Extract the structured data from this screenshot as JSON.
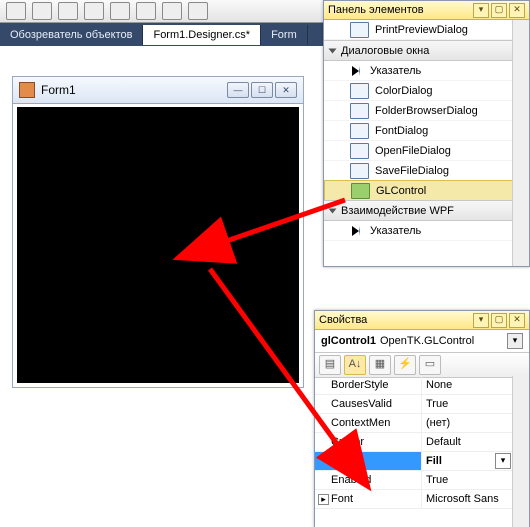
{
  "topToolbarIconCount": 8,
  "docTabs": {
    "t1": "Обозреватель объектов",
    "t2": "Form1.Designer.cs*",
    "t3": "Form"
  },
  "form1": {
    "title": "Form1"
  },
  "toolbox": {
    "title": "Панель элементов",
    "items": {
      "printPreview": "PrintPreviewDialog",
      "group1": "Диалоговые окна",
      "pointer1": "Указатель",
      "color": "ColorDialog",
      "folder": "FolderBrowserDialog",
      "font": "FontDialog",
      "open": "OpenFileDialog",
      "save": "SaveFileDialog",
      "gl": "GLControl",
      "group2": "Взаимодействие WPF",
      "pointer2": "Указатель"
    }
  },
  "props": {
    "title": "Свойства",
    "objName": "glControl1",
    "objType": "OpenTK.GLControl",
    "rows": {
      "borderStyle": {
        "k": "BorderStyle",
        "v": "None"
      },
      "causesValid": {
        "k": "CausesValid",
        "v": "True"
      },
      "contextMenu": {
        "k": "ContextMen",
        "v": "(нет)"
      },
      "cursor": {
        "k": "Cursor",
        "v": "Default"
      },
      "dock": {
        "k": "Dock",
        "v": "Fill"
      },
      "enabled": {
        "k": "Enabled",
        "v": "True"
      },
      "font": {
        "k": "Font",
        "v": "Microsoft Sans"
      }
    }
  }
}
